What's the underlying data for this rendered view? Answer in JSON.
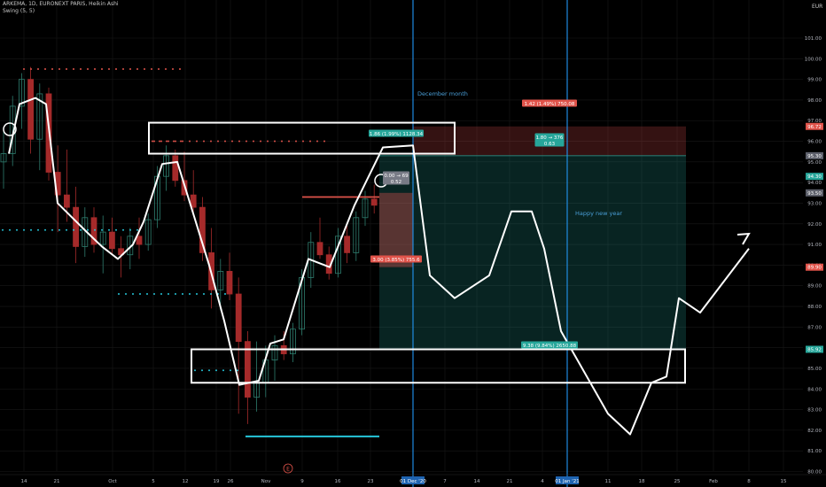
{
  "header": {
    "title": "ARKEMA, 1D, EURONEXT PARIS, Heikin Ashi",
    "indicator": "Swing (5, 5)",
    "currency": "EUR"
  },
  "colors": {
    "background": "#000000",
    "up_candle": "#2e7d6e",
    "down_candle": "#a52a2a",
    "grid": "#181818",
    "swing_high_dots": "#e0534a",
    "swing_low_dots": "#26c6da",
    "vertical_marker": "#2196f3",
    "drawing": "#ffffff",
    "profit_zone": "rgba(38,166,154,0.22)",
    "loss_zone": "rgba(239,83,80,0.22)"
  },
  "annotations": {
    "december": "December month",
    "new_year": "Happy new year",
    "earnings_marker": "E"
  },
  "position_labels": [
    {
      "id": "top",
      "text": "1.42 (1.49%) 750.08",
      "color": "#e0534a"
    },
    {
      "id": "target",
      "text": "1.86 (1.99%) 1128.34",
      "color": "#26a69a"
    },
    {
      "id": "rr1",
      "text": "1.80 → 376",
      "color": "#26a69a"
    },
    {
      "id": "rr2",
      "text": "0.63",
      "color": "#26a69a"
    },
    {
      "id": "entry1",
      "text": "0.00 → 69",
      "color": "#787b86"
    },
    {
      "id": "entry2",
      "text": "0.52",
      "color": "#787b86"
    },
    {
      "id": "stop",
      "text": "3.00 (3.85%) 755.6",
      "color": "#e0534a"
    },
    {
      "id": "bottom",
      "text": "9.38 (9.84%) 2650.88",
      "color": "#26a69a"
    }
  ],
  "price_badges": [
    {
      "value": "96.72",
      "color": "#e0534a"
    },
    {
      "value": "95.30",
      "color": "#5d606b"
    },
    {
      "value": "94.30",
      "color": "#26a69a"
    },
    {
      "value": "93.50",
      "color": "#5d606b"
    },
    {
      "value": "89.90",
      "color": "#e0534a"
    },
    {
      "value": "85.92",
      "color": "#26a69a"
    }
  ],
  "date_badges": [
    "01 Dec '20",
    "01 Jan '21"
  ],
  "chart_data": {
    "type": "candlestick",
    "y_ticks": [
      "80.00",
      "81.00",
      "82.00",
      "83.00",
      "84.00",
      "85.00",
      "86.00",
      "87.00",
      "88.00",
      "89.00",
      "90.00",
      "91.00",
      "92.00",
      "93.00",
      "94.00",
      "95.00",
      "96.00",
      "97.00",
      "98.00",
      "99.00",
      "100.00",
      "101.00"
    ],
    "ylim": [
      80,
      101.5
    ],
    "x_ticks": [
      "14",
      "21",
      "Oct",
      "5",
      "12",
      "19",
      "26",
      "Nov",
      "9",
      "16",
      "23",
      "7",
      "14",
      "21",
      "4",
      "11",
      "18",
      "25",
      "Feb",
      "8",
      "15"
    ],
    "date_badges": [
      "01 Dec '20",
      "01 Jan '21"
    ],
    "candles": [
      {
        "o": 95.0,
        "h": 96.6,
        "l": 93.7,
        "c": 95.4
      },
      {
        "o": 95.4,
        "h": 98.2,
        "l": 94.8,
        "c": 97.7
      },
      {
        "o": 97.7,
        "h": 99.3,
        "l": 96.6,
        "c": 99.0
      },
      {
        "o": 99.0,
        "h": 99.6,
        "l": 95.4,
        "c": 96.1
      },
      {
        "o": 96.1,
        "h": 98.8,
        "l": 94.6,
        "c": 98.3
      },
      {
        "o": 98.3,
        "h": 98.6,
        "l": 94.1,
        "c": 94.5
      },
      {
        "o": 94.5,
        "h": 95.8,
        "l": 91.6,
        "c": 93.4
      },
      {
        "o": 93.4,
        "h": 95.6,
        "l": 92.1,
        "c": 92.8
      },
      {
        "o": 92.8,
        "h": 93.8,
        "l": 90.1,
        "c": 90.9
      },
      {
        "o": 90.9,
        "h": 92.8,
        "l": 90.4,
        "c": 92.3
      },
      {
        "o": 92.3,
        "h": 92.8,
        "l": 90.6,
        "c": 91.0
      },
      {
        "o": 91.0,
        "h": 92.4,
        "l": 89.6,
        "c": 91.6
      },
      {
        "o": 91.6,
        "h": 92.3,
        "l": 90.5,
        "c": 90.8
      },
      {
        "o": 90.8,
        "h": 91.4,
        "l": 89.4,
        "c": 90.5
      },
      {
        "o": 90.5,
        "h": 91.8,
        "l": 89.8,
        "c": 91.4
      },
      {
        "o": 91.4,
        "h": 92.3,
        "l": 90.3,
        "c": 91.0
      },
      {
        "o": 91.0,
        "h": 92.5,
        "l": 90.7,
        "c": 92.2
      },
      {
        "o": 92.2,
        "h": 94.8,
        "l": 91.8,
        "c": 94.3
      },
      {
        "o": 94.3,
        "h": 95.8,
        "l": 93.6,
        "c": 95.3
      },
      {
        "o": 95.3,
        "h": 95.6,
        "l": 93.8,
        "c": 94.1
      },
      {
        "o": 94.1,
        "h": 95.5,
        "l": 93.1,
        "c": 93.4
      },
      {
        "o": 93.4,
        "h": 94.6,
        "l": 92.5,
        "c": 92.8
      },
      {
        "o": 92.8,
        "h": 93.3,
        "l": 90.2,
        "c": 90.6
      },
      {
        "o": 90.6,
        "h": 91.8,
        "l": 87.9,
        "c": 88.8
      },
      {
        "o": 88.8,
        "h": 90.3,
        "l": 87.8,
        "c": 89.7
      },
      {
        "o": 89.7,
        "h": 90.6,
        "l": 88.3,
        "c": 88.6
      },
      {
        "o": 88.6,
        "h": 89.4,
        "l": 82.8,
        "c": 86.3
      },
      {
        "o": 86.3,
        "h": 86.8,
        "l": 82.3,
        "c": 83.6
      },
      {
        "o": 83.6,
        "h": 86.3,
        "l": 82.9,
        "c": 84.3
      },
      {
        "o": 84.3,
        "h": 86.1,
        "l": 83.6,
        "c": 85.4
      },
      {
        "o": 85.4,
        "h": 86.6,
        "l": 84.4,
        "c": 86.1
      },
      {
        "o": 86.1,
        "h": 86.8,
        "l": 85.4,
        "c": 85.7
      },
      {
        "o": 85.7,
        "h": 87.2,
        "l": 85.3,
        "c": 86.9
      },
      {
        "o": 86.9,
        "h": 89.8,
        "l": 86.6,
        "c": 89.4
      },
      {
        "o": 89.4,
        "h": 91.6,
        "l": 88.9,
        "c": 91.1
      },
      {
        "o": 91.1,
        "h": 92.3,
        "l": 90.3,
        "c": 90.5
      },
      {
        "o": 90.5,
        "h": 90.9,
        "l": 89.3,
        "c": 89.6
      },
      {
        "o": 89.6,
        "h": 91.8,
        "l": 89.4,
        "c": 91.4
      },
      {
        "o": 91.4,
        "h": 91.9,
        "l": 90.1,
        "c": 90.6
      },
      {
        "o": 90.6,
        "h": 92.6,
        "l": 90.2,
        "c": 92.3
      },
      {
        "o": 92.3,
        "h": 93.6,
        "l": 91.9,
        "c": 93.2
      },
      {
        "o": 93.2,
        "h": 93.9,
        "l": 92.5,
        "c": 92.9
      }
    ],
    "swing_high_levels": [
      99.5,
      96.0,
      96.0,
      93.3
    ],
    "swing_low_levels": [
      91.7,
      88.6,
      84.9,
      81.7
    ],
    "drawn_path_prices": [
      95.4,
      97.8,
      98.1,
      97.8,
      93.0,
      91.6,
      90.9,
      90.3,
      91.0,
      92.1,
      94.9,
      95.0,
      92.5,
      90.0,
      87.3,
      84.2,
      84.4,
      86.2,
      86.4,
      90.3,
      89.9,
      92.9,
      95.7,
      95.8,
      89.5,
      88.4,
      89.5,
      92.6,
      92.6,
      90.8,
      86.8,
      82.8,
      81.8,
      84.3,
      84.6,
      88.4,
      87.7,
      90.8
    ],
    "position_top": 96.72,
    "position_target": 95.3,
    "position_entry": 93.5,
    "position_stop": 89.9,
    "consolidation_box": [
      95.4,
      96.9
    ],
    "support_box": [
      84.3,
      85.92
    ]
  }
}
